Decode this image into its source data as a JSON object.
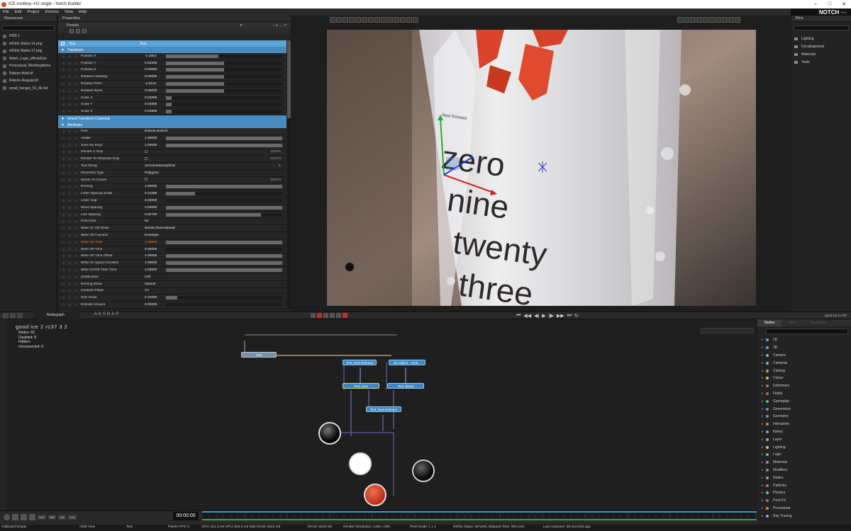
{
  "window": {
    "title": "ICE-rootboy--H2 single - Notch Builder",
    "logo": "NOTCH",
    "logo_sub": "PRO"
  },
  "menu": [
    "File",
    "Edit",
    "Project",
    "Devices",
    "View",
    "Help"
  ],
  "resources": {
    "header": "Resources",
    "items": [
      "HDR 1",
      "mDirts Stains 14.png",
      "mDirts Stains 17.png",
      "Notch_Logo_officialUse",
      "Procedural_Meshingdemo",
      "Roboto-Bold.ttf",
      "Roboto-Regular.ttf",
      "small_hangar_01_4k.hdr"
    ]
  },
  "properties": {
    "header": "Properties",
    "presets_label": "Presets",
    "node_header": {
      "name": "Text",
      "type": "Text"
    },
    "sections": {
      "transform": "Transform",
      "inherit": "Inherit Transform Channels",
      "attributes": "Attributes"
    },
    "transform_rows": [
      {
        "name": "Position X",
        "value": "-1.1854",
        "fill": 0.45
      },
      {
        "name": "Position Y",
        "value": "0.04348",
        "fill": 0.5
      },
      {
        "name": "Position Z",
        "value": "0.00000",
        "fill": 0.5
      },
      {
        "name": "Rotation Heading",
        "value": "0.00000",
        "fill": 0.5
      },
      {
        "name": "Rotation Pitch",
        "value": "-2.5210",
        "fill": 0.5
      },
      {
        "name": "Rotation Bank",
        "value": "0.00000",
        "fill": 0.5
      },
      {
        "name": "Scale X",
        "value": "0.04898",
        "fill": 0.05
      },
      {
        "name": "Scale Y",
        "value": "0.04898",
        "fill": 0.05
      },
      {
        "name": "Scale Z",
        "value": "0.04898",
        "fill": 0.05
      }
    ],
    "attribute_rows": [
      {
        "name": "Font",
        "value": "Roboto-Bold.ttf"
      },
      {
        "name": "Visible",
        "value": "1.00000",
        "fill": 1.0
      },
      {
        "name": "Seen By Rays",
        "value": "1.00000",
        "fill": 1.0
      },
      {
        "name": "Render Z Only",
        "check": true,
        "shortcut": "Ctrl-F1"
      },
      {
        "name": "Render To Shadows Only",
        "check": true,
        "shortcut": "Ctrl-F2"
      },
      {
        "name": "Text String",
        "value": "zeroninetwentythree",
        "shortcut": "S"
      },
      {
        "name": "Geometry Type",
        "value": "Polygons"
      },
      {
        "name": "Words To Clones",
        "check": true,
        "shortcut": "Ctrl-F3"
      },
      {
        "name": "Kerning",
        "value": "1.00000",
        "fill": 1.0
      },
      {
        "name": "Letter Spacing Scale",
        "value": "0.41088",
        "fill": 0.25
      },
      {
        "name": "Letter Gap",
        "value": "0.00000",
        "fill": 0.0
      },
      {
        "name": "Word Spacing",
        "value": "2.00000",
        "fill": 1.0
      },
      {
        "name": "Line Spacing",
        "value": "0.82780",
        "fill": 0.82
      },
      {
        "name": "Point Size",
        "value": "64"
      },
      {
        "name": "Write On Off Mode",
        "value": "Words (Normalised)"
      },
      {
        "name": "Write Off Function",
        "value": "Envelope"
      },
      {
        "name": "Write On Time",
        "value": "1.00000",
        "fill": 1.0,
        "highlight": true
      },
      {
        "name": "Write Off Time",
        "value": "0.00000",
        "fill": 0.0
      },
      {
        "name": "Write Off Time Offset",
        "value": "1.00000",
        "fill": 1.0
      },
      {
        "name": "Write On Space Duration",
        "value": "1.00000",
        "fill": 1.0
      },
      {
        "name": "Write On/Off Fade Time",
        "value": "1.00000",
        "fill": 1.0
      },
      {
        "name": "Justification",
        "value": "Left"
      },
      {
        "name": "Kerning Mode",
        "value": "Optical"
      },
      {
        "name": "Creation Plane",
        "value": "XY"
      },
      {
        "name": "Size Scale",
        "value": "0.10000",
        "fill": 0.1
      },
      {
        "name": "Extrude Amount",
        "value": "0.00000",
        "fill": 0.0
      }
    ]
  },
  "viewport": {
    "text_lines": [
      "zero",
      "nine",
      "twenty",
      "three"
    ],
    "gizmo_label": "New Release"
  },
  "bins": {
    "header": "Bins",
    "items": [
      "Lighting",
      "Uncategorised",
      "Materials",
      "Tools"
    ]
  },
  "nodegraph": {
    "tab": "Nodegraph",
    "letters": [
      "A",
      "K",
      "S",
      "N",
      "A",
      "P"
    ],
    "layer_title": "good ice 2 rc37 3 2",
    "stats": [
      "Nodes: 60",
      "Disabled: 8",
      "Hidden:",
      "Unconnected: 9"
    ],
    "nodes": [
      {
        "label": "Text",
        "color": "#7b8fa8"
      },
      {
        "label": "Text: New Release",
        "color": "#3a86c8"
      },
      {
        "label": "3D Object - strok...",
        "color": "#3a86c8"
      },
      {
        "label": "Text: zero",
        "color": "#3a86c8"
      },
      {
        "label": "Text: (beta)",
        "color": "#3a86c8"
      },
      {
        "label": "Text: New Release",
        "color": "#3a86c8"
      }
    ]
  },
  "nodes_panel": {
    "tabs": [
      "Nodes",
      "Bins",
      "Properties"
    ],
    "categories": [
      {
        "name": "2D",
        "color": "#6aa0d8"
      },
      {
        "name": "3D",
        "color": "#6aa0d8"
      },
      {
        "name": "Camera",
        "color": "#6ac0d8"
      },
      {
        "name": "Cameras",
        "color": "#6ac0d8"
      },
      {
        "name": "Cloning",
        "color": "#c0a060"
      },
      {
        "name": "Colour",
        "color": "#d0c060"
      },
      {
        "name": "Deformers",
        "color": "#c07060"
      },
      {
        "name": "Fields",
        "color": "#d06060"
      },
      {
        "name": "Gameplay",
        "color": "#60c080"
      },
      {
        "name": "Generators",
        "color": "#8080d0"
      },
      {
        "name": "Geometry",
        "color": "#6090d0"
      },
      {
        "name": "Interactive",
        "color": "#d08040"
      },
      {
        "name": "Kinect",
        "color": "#60b0b0"
      },
      {
        "name": "Layer",
        "color": "#a0a0a0"
      },
      {
        "name": "Lighting",
        "color": "#e0c040"
      },
      {
        "name": "Logic",
        "color": "#80c060"
      },
      {
        "name": "Materials",
        "color": "#c080c0"
      },
      {
        "name": "Modifiers",
        "color": "#60a0d0"
      },
      {
        "name": "Nodes",
        "color": "#a0a0a0"
      },
      {
        "name": "Particles",
        "color": "#e07040"
      },
      {
        "name": "Physics",
        "color": "#70c0a0"
      },
      {
        "name": "Post-FX",
        "color": "#c06090"
      },
      {
        "name": "Procedural",
        "color": "#d09040"
      },
      {
        "name": "Ray Tracing",
        "color": "#90a0e0"
      }
    ]
  },
  "bottom": {
    "timecode": "00:00:00",
    "buttons": [
      "REC",
      "BIN",
      "VID",
      "LOG"
    ],
    "layer_name": "good ice 2 rc37"
  },
  "status": {
    "clipboard": "Clipboard Empty",
    "view": "Orbit View",
    "selected": "Text",
    "parent": "Parent  FPS: 0",
    "gpu": "GPU: 811.3 ms  CPU: 693.0 ms  Main RAM: 2821 mb",
    "vram": "VRAM: 5818 mb",
    "render_res": "Render Resolution: 1292 x 830",
    "pixel_scale": "Pixel Scale: 1 x 1",
    "refine": "Refine Steps: 48/1000, Elapsed Time: 00m:34s",
    "autosave": "Last Autosave: 39 seconds ago"
  }
}
